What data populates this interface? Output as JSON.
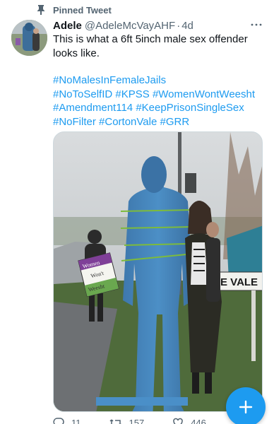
{
  "pinned": {
    "label": "Pinned Tweet",
    "icon": "pin-icon"
  },
  "tweet": {
    "author_name": "Adele",
    "author_handle": "@AdeleMcVayAHF",
    "separator": "·",
    "time": "4d",
    "text": "This is what a 6ft 5inch male sex offender looks like.",
    "hashtags": [
      "#NoMalesInFemaleJails",
      "#NoToSelfID",
      "#KPSS",
      "#WomenWontWeesht",
      "#Amendment114",
      "#KeepPrisonSingleSex",
      "#NoFilter",
      "#CortonVale",
      "#GRR"
    ],
    "media": {
      "sign_line1": "Women",
      "sign_line2": "Won't",
      "sign_line3": "Weesht",
      "road_sign": "E VALE"
    },
    "counts": {
      "replies": "11",
      "retweets": "157",
      "likes": "446"
    }
  },
  "colors": {
    "accent": "#1d9bf0",
    "muted": "#536471",
    "text": "#0f1419"
  },
  "fab": {
    "icon": "compose-plus-icon"
  }
}
